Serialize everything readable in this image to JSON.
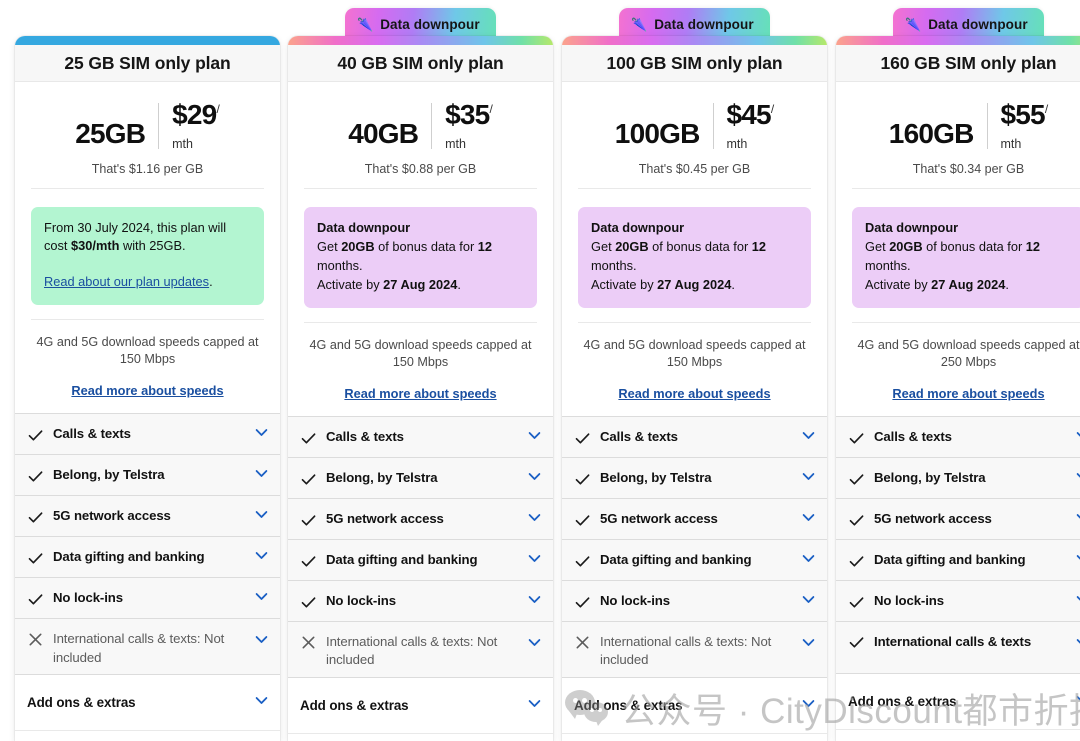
{
  "page": {
    "background": "#ffffff",
    "link_color": "#1a4fa0",
    "accent_blue": "#35a8e0"
  },
  "badge": {
    "label": "Data downpour",
    "icon": "umbrella-icon",
    "icon_glyph": "🌂",
    "gradient_from": "#f472d0",
    "gradient_to": "#66e0b8"
  },
  "labels": {
    "addons": "Add ons & extras",
    "speeds_link": "Read more about speeds",
    "per_gb_prefix": "That's",
    "per_gb_suffix": "per GB",
    "mth": "mth",
    "slash": "/"
  },
  "plans": [
    {
      "title": "25 GB SIM only plan",
      "accent_type": "solid",
      "accent_color": "#35a8e0",
      "has_badge": false,
      "data_amount": "25GB",
      "price": "$29",
      "per_gb": "That's $1.16 per GB",
      "promo": {
        "style": "green",
        "kind": "price-change",
        "line1_a": "From 30 July 2024, this plan will cost ",
        "line1_b": "$30/mth",
        "line1_c": " with 25GB.",
        "link": "Read about our plan updates",
        "link_suffix": "."
      },
      "speed": "4G and 5G download speeds capped at 150 Mbps",
      "speed_link": "Read more about speeds",
      "features": [
        {
          "label": "Calls & texts",
          "included": true
        },
        {
          "label": "Belong, by Telstra",
          "included": true
        },
        {
          "label": "5G network access",
          "included": true
        },
        {
          "label": "Data gifting and banking",
          "included": true
        },
        {
          "label": "No lock-ins",
          "included": true
        },
        {
          "label": "International calls & texts: Not included",
          "included": false
        }
      ],
      "addons": "Add ons & extras"
    },
    {
      "title": "40 GB SIM only plan",
      "accent_type": "grad",
      "has_badge": true,
      "data_amount": "40GB",
      "price": "$35",
      "per_gb": "That's $0.88 per GB",
      "promo": {
        "style": "purple",
        "kind": "downpour",
        "title": "Data downpour",
        "line1_a": "Get ",
        "line1_b": "20GB",
        "line1_c": " of bonus data for ",
        "line1_d": "12",
        "line1_e": " months.",
        "line2_a": "Activate by ",
        "line2_b": "27 Aug 2024",
        "line2_c": "."
      },
      "speed": "4G and 5G download speeds capped at 150 Mbps",
      "speed_link": "Read more about speeds",
      "features": [
        {
          "label": "Calls & texts",
          "included": true
        },
        {
          "label": "Belong, by Telstra",
          "included": true
        },
        {
          "label": "5G network access",
          "included": true
        },
        {
          "label": "Data gifting and banking",
          "included": true
        },
        {
          "label": "No lock-ins",
          "included": true
        },
        {
          "label": "International calls & texts: Not included",
          "included": false
        }
      ],
      "addons": "Add ons & extras"
    },
    {
      "title": "100 GB SIM only plan",
      "accent_type": "grad",
      "has_badge": true,
      "data_amount": "100GB",
      "price": "$45",
      "per_gb": "That's $0.45 per GB",
      "promo": {
        "style": "purple",
        "kind": "downpour",
        "title": "Data downpour",
        "line1_a": "Get ",
        "line1_b": "20GB",
        "line1_c": " of bonus data for ",
        "line1_d": "12",
        "line1_e": " months.",
        "line2_a": "Activate by ",
        "line2_b": "27 Aug 2024",
        "line2_c": "."
      },
      "speed": "4G and 5G download speeds capped at 150 Mbps",
      "speed_link": "Read more about speeds",
      "features": [
        {
          "label": "Calls & texts",
          "included": true
        },
        {
          "label": "Belong, by Telstra",
          "included": true
        },
        {
          "label": "5G network access",
          "included": true
        },
        {
          "label": "Data gifting and banking",
          "included": true
        },
        {
          "label": "No lock-ins",
          "included": true
        },
        {
          "label": "International calls & texts: Not included",
          "included": false
        }
      ],
      "addons": "Add ons & extras"
    },
    {
      "title": "160 GB SIM only plan",
      "accent_type": "grad",
      "has_badge": true,
      "data_amount": "160GB",
      "price": "$55",
      "per_gb": "That's $0.34 per GB",
      "promo": {
        "style": "purple",
        "kind": "downpour",
        "title": "Data downpour",
        "line1_a": "Get ",
        "line1_b": "20GB",
        "line1_c": " of bonus data for ",
        "line1_d": "12",
        "line1_e": " months.",
        "line2_a": "Activate by ",
        "line2_b": "27 Aug 2024",
        "line2_c": "."
      },
      "speed": "4G and 5G download speeds capped at 250 Mbps",
      "speed_link": "Read more about speeds",
      "features": [
        {
          "label": "Calls & texts",
          "included": true
        },
        {
          "label": "Belong, by Telstra",
          "included": true
        },
        {
          "label": "5G network access",
          "included": true
        },
        {
          "label": "Data gifting and banking",
          "included": true
        },
        {
          "label": "No lock-ins",
          "included": true
        },
        {
          "label": "International calls & texts",
          "included": true
        }
      ],
      "addons": "Add ons & extras"
    }
  ],
  "watermark": {
    "text": "公众号 · CityDiscount都市折扣",
    "logo": "wechat-logo",
    "color": "#a3a3a3"
  }
}
